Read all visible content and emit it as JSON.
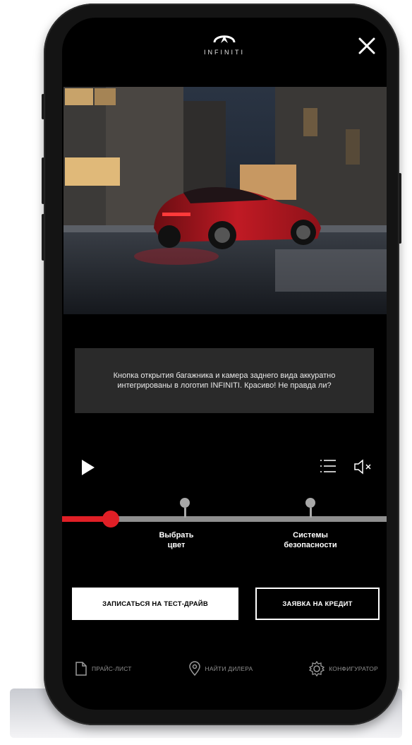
{
  "brand": {
    "name": "INFINITI"
  },
  "video": {
    "caption": "Кнопка открытия багажника и камера заднего вида аккуратно интегрированы в логотип INFINITI. Красиво! Не правда ли?",
    "progress_percent": 15
  },
  "timeline": {
    "markers": [
      {
        "label_line1": "Выбрать",
        "label_line2": "цвет"
      },
      {
        "label_line1": "Системы",
        "label_line2": "безопасности"
      }
    ]
  },
  "actions": {
    "test_drive_label": "ЗАПИСАТЬСЯ НА ТЕСТ-ДРАЙВ",
    "credit_label": "ЗАЯВКА НА КРЕДИТ"
  },
  "footer": {
    "items": [
      {
        "label": "ПРАЙС-ЛИСТ",
        "icon": "document-icon"
      },
      {
        "label": "НАЙТИ ДИЛЕРА",
        "icon": "location-pin-icon"
      },
      {
        "label": "КОНФИГУРАТОР",
        "icon": "gear-icon"
      }
    ]
  },
  "colors": {
    "accent": "#e01f26",
    "background": "#000000",
    "caption_bg": "#2a2a2a"
  }
}
